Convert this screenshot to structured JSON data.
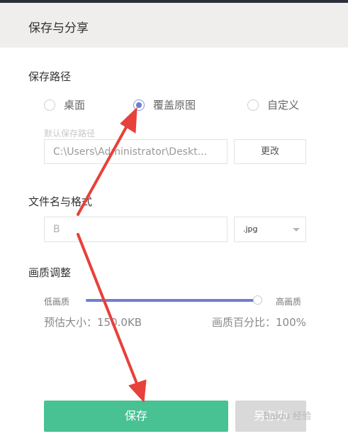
{
  "dialog": {
    "title": "保存与分享"
  },
  "save_path": {
    "heading": "保存路径",
    "options": [
      {
        "label": "桌面",
        "checked": false
      },
      {
        "label": "覆盖原图",
        "checked": true
      },
      {
        "label": "自定义",
        "checked": false
      }
    ],
    "default_hint": "默认保存路径",
    "path_value": "C:\\Users\\Administrator\\Deskt...",
    "change_button": "更改"
  },
  "file": {
    "heading": "文件名与格式",
    "name_value": "B",
    "format_value": ".jpg"
  },
  "quality": {
    "heading": "画质调整",
    "low_label": "低画质",
    "high_label": "高画质",
    "level_percent": 100,
    "estimated_size": "预估大小：150.0KB",
    "percent_text": "画质百分比：100%"
  },
  "actions": {
    "save_label": "保存",
    "save_as_label": "另存为"
  },
  "watermark": {
    "text": "Baidu 经验"
  },
  "colors": {
    "accent": "#6b7dd4",
    "save_button": "#48c193",
    "arrow": "#e8403a"
  }
}
